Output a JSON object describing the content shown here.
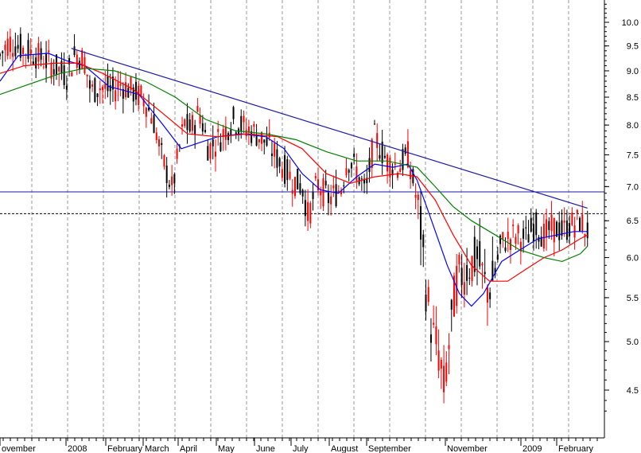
{
  "chart_data": {
    "type": "line",
    "scale": "log",
    "ylim": [
      4.2,
      10.8
    ],
    "y_ticks": [
      10.0,
      9.5,
      9.0,
      8.5,
      8.0,
      7.5,
      7.0,
      6.5,
      6.0,
      5.5,
      5.0,
      4.5
    ],
    "x_tick_labels": [
      "ovember",
      "2008",
      "February",
      "March",
      "April",
      "May",
      "June",
      "July",
      "August",
      "September",
      "November",
      "2009",
      "February"
    ],
    "grid": true,
    "horizontal_lines": [
      {
        "value": 6.92,
        "style": "solid",
        "color": "#1a1aa6"
      },
      {
        "value": 6.6,
        "style": "dashed",
        "color": "#000000"
      }
    ],
    "trendline": {
      "color": "#1a1aa6",
      "start": [
        0.118,
        9.45
      ],
      "end": [
        0.972,
        6.68
      ]
    },
    "price_key_points": [
      [
        0.0,
        9.3
      ],
      [
        0.015,
        9.6
      ],
      [
        0.035,
        9.45
      ],
      [
        0.055,
        9.35
      ],
      [
        0.075,
        9.2
      ],
      [
        0.095,
        9.05
      ],
      [
        0.11,
        8.9
      ],
      [
        0.125,
        9.35
      ],
      [
        0.14,
        9.2
      ],
      [
        0.15,
        8.6
      ],
      [
        0.165,
        8.7
      ],
      [
        0.185,
        8.6
      ],
      [
        0.2,
        8.75
      ],
      [
        0.22,
        8.6
      ],
      [
        0.24,
        8.45
      ],
      [
        0.255,
        8.05
      ],
      [
        0.265,
        7.55
      ],
      [
        0.275,
        7.25
      ],
      [
        0.285,
        6.95
      ],
      [
        0.295,
        7.5
      ],
      [
        0.305,
        8.05
      ],
      [
        0.315,
        7.9
      ],
      [
        0.33,
        8.25
      ],
      [
        0.345,
        7.6
      ],
      [
        0.365,
        7.8
      ],
      [
        0.385,
        8.1
      ],
      [
        0.405,
        7.95
      ],
      [
        0.425,
        7.85
      ],
      [
        0.445,
        7.65
      ],
      [
        0.465,
        7.35
      ],
      [
        0.485,
        7.1
      ],
      [
        0.5,
        7.0
      ],
      [
        0.51,
        6.55
      ],
      [
        0.525,
        7.05
      ],
      [
        0.545,
        6.8
      ],
      [
        0.565,
        7.0
      ],
      [
        0.575,
        7.45
      ],
      [
        0.59,
        7.25
      ],
      [
        0.605,
        6.9
      ],
      [
        0.62,
        7.8
      ],
      [
        0.64,
        7.4
      ],
      [
        0.66,
        7.3
      ],
      [
        0.675,
        7.5
      ],
      [
        0.685,
        7.0
      ],
      [
        0.695,
        6.5
      ],
      [
        0.705,
        5.6
      ],
      [
        0.715,
        5.1
      ],
      [
        0.725,
        4.9
      ],
      [
        0.735,
        4.5
      ],
      [
        0.745,
        5.1
      ],
      [
        0.755,
        5.7
      ],
      [
        0.765,
        5.8
      ],
      [
        0.775,
        5.9
      ],
      [
        0.79,
        6.0
      ],
      [
        0.805,
        5.6
      ],
      [
        0.815,
        5.7
      ],
      [
        0.83,
        6.2
      ],
      [
        0.85,
        6.3
      ],
      [
        0.87,
        6.25
      ],
      [
        0.885,
        6.45
      ],
      [
        0.9,
        6.3
      ],
      [
        0.915,
        6.4
      ],
      [
        0.93,
        6.35
      ],
      [
        0.945,
        6.45
      ],
      [
        0.96,
        6.5
      ],
      [
        0.972,
        6.35
      ]
    ],
    "series": [
      {
        "color": "#0000ff",
        "values": [
          [
            0.0,
            8.8
          ],
          [
            0.03,
            9.3
          ],
          [
            0.08,
            9.35
          ],
          [
            0.11,
            9.2
          ],
          [
            0.14,
            9.1
          ],
          [
            0.18,
            8.7
          ],
          [
            0.23,
            8.55
          ],
          [
            0.27,
            8.0
          ],
          [
            0.3,
            7.6
          ],
          [
            0.33,
            7.7
          ],
          [
            0.36,
            7.8
          ],
          [
            0.4,
            7.85
          ],
          [
            0.44,
            7.8
          ],
          [
            0.47,
            7.6
          ],
          [
            0.5,
            7.2
          ],
          [
            0.53,
            6.95
          ],
          [
            0.56,
            6.9
          ],
          [
            0.59,
            7.15
          ],
          [
            0.62,
            7.35
          ],
          [
            0.65,
            7.3
          ],
          [
            0.675,
            7.35
          ],
          [
            0.69,
            7.1
          ],
          [
            0.71,
            6.6
          ],
          [
            0.74,
            5.9
          ],
          [
            0.76,
            5.55
          ],
          [
            0.78,
            5.4
          ],
          [
            0.8,
            5.55
          ],
          [
            0.83,
            5.95
          ],
          [
            0.86,
            6.1
          ],
          [
            0.89,
            6.25
          ],
          [
            0.92,
            6.3
          ],
          [
            0.95,
            6.35
          ],
          [
            0.972,
            6.35
          ]
        ]
      },
      {
        "color": "#ff0000",
        "values": [
          [
            0.0,
            8.95
          ],
          [
            0.04,
            9.1
          ],
          [
            0.09,
            9.15
          ],
          [
            0.13,
            9.15
          ],
          [
            0.17,
            8.95
          ],
          [
            0.22,
            8.65
          ],
          [
            0.27,
            8.2
          ],
          [
            0.31,
            7.85
          ],
          [
            0.36,
            7.8
          ],
          [
            0.41,
            7.85
          ],
          [
            0.46,
            7.8
          ],
          [
            0.5,
            7.6
          ],
          [
            0.54,
            7.2
          ],
          [
            0.58,
            7.05
          ],
          [
            0.62,
            7.15
          ],
          [
            0.66,
            7.2
          ],
          [
            0.69,
            7.15
          ],
          [
            0.72,
            6.8
          ],
          [
            0.75,
            6.3
          ],
          [
            0.78,
            5.9
          ],
          [
            0.81,
            5.7
          ],
          [
            0.84,
            5.7
          ],
          [
            0.87,
            5.85
          ],
          [
            0.9,
            6.0
          ],
          [
            0.93,
            6.1
          ],
          [
            0.96,
            6.25
          ],
          [
            0.972,
            6.3
          ]
        ]
      },
      {
        "color": "#008000",
        "values": [
          [
            0.0,
            8.55
          ],
          [
            0.05,
            8.75
          ],
          [
            0.1,
            8.95
          ],
          [
            0.14,
            9.05
          ],
          [
            0.19,
            9.0
          ],
          [
            0.24,
            8.8
          ],
          [
            0.29,
            8.5
          ],
          [
            0.34,
            8.1
          ],
          [
            0.39,
            7.9
          ],
          [
            0.44,
            7.85
          ],
          [
            0.49,
            7.75
          ],
          [
            0.54,
            7.55
          ],
          [
            0.59,
            7.4
          ],
          [
            0.64,
            7.4
          ],
          [
            0.69,
            7.3
          ],
          [
            0.72,
            7.0
          ],
          [
            0.75,
            6.7
          ],
          [
            0.78,
            6.5
          ],
          [
            0.82,
            6.3
          ],
          [
            0.86,
            6.1
          ],
          [
            0.9,
            6.0
          ],
          [
            0.93,
            5.95
          ],
          [
            0.96,
            6.05
          ],
          [
            0.972,
            6.15
          ]
        ]
      }
    ]
  }
}
